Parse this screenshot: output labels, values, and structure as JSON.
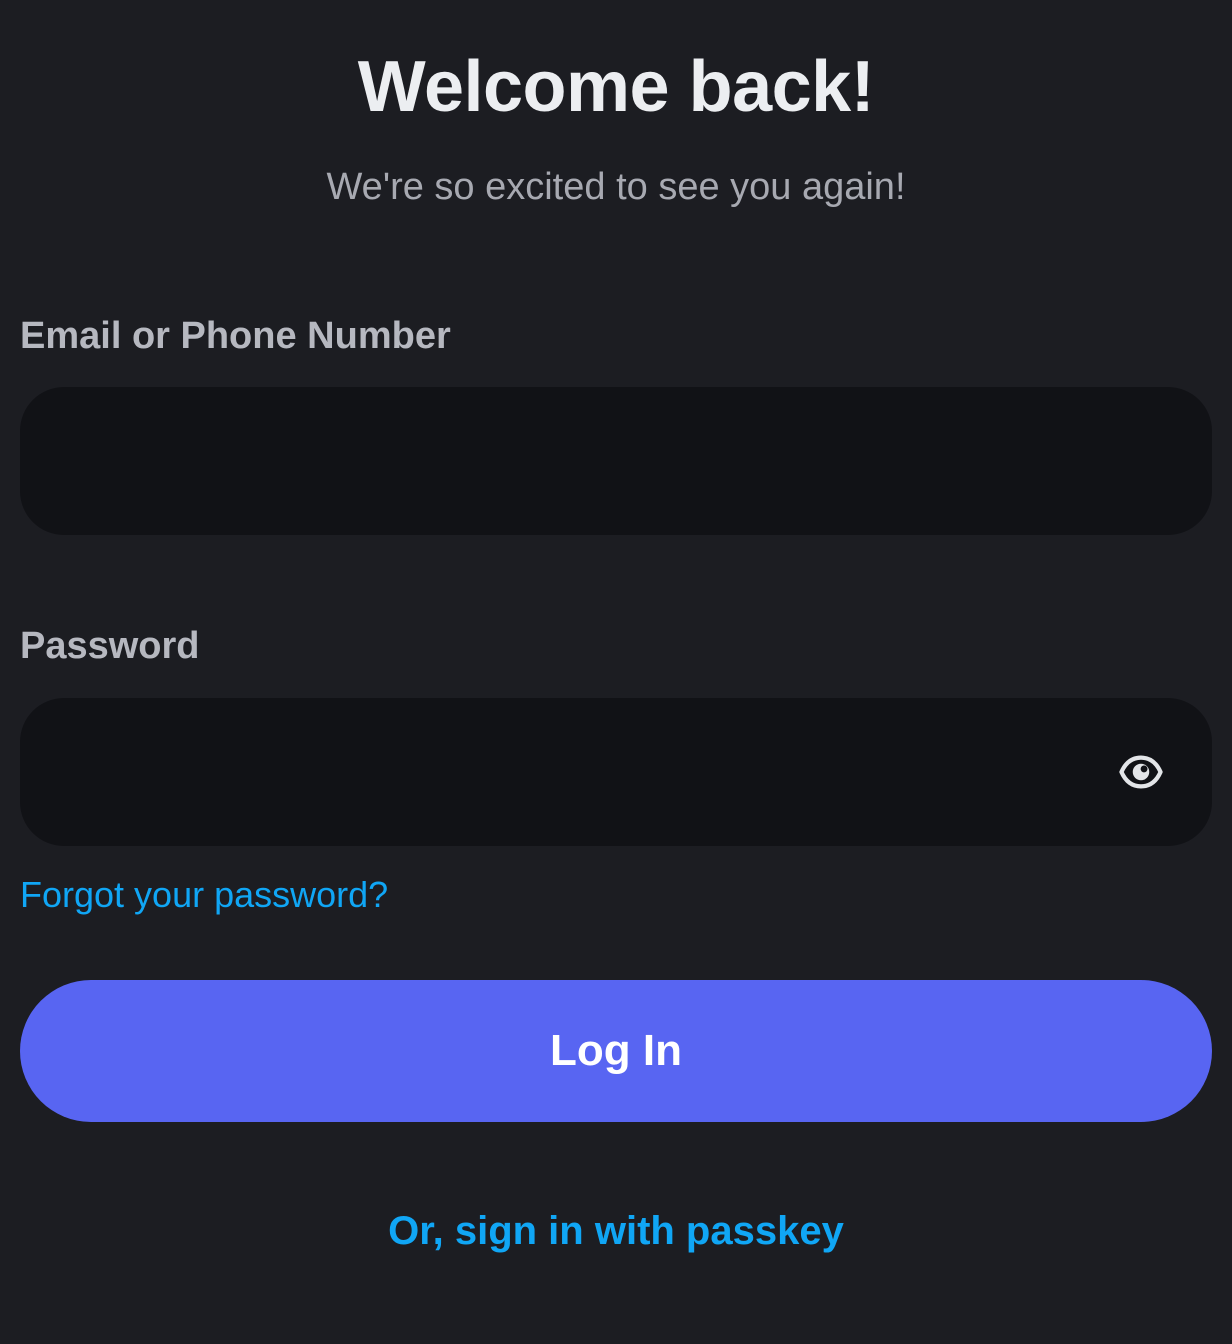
{
  "header": {
    "title": "Welcome back!",
    "subtitle": "We're so excited to see you again!"
  },
  "form": {
    "email": {
      "label": "Email or Phone Number",
      "value": "",
      "placeholder": ""
    },
    "password": {
      "label": "Password",
      "value": "",
      "placeholder": "",
      "toggle_icon": "eye-icon"
    },
    "forgot_password_text": "Forgot your password?",
    "login_button_label": "Log In",
    "passkey_link_text": "Or, sign in with passkey"
  },
  "colors": {
    "background": "#1c1d22",
    "input_background": "#111216",
    "accent": "#5865f2",
    "link": "#10a6f5",
    "label": "#b6b8c0",
    "subtitle": "#a7a9b1"
  }
}
